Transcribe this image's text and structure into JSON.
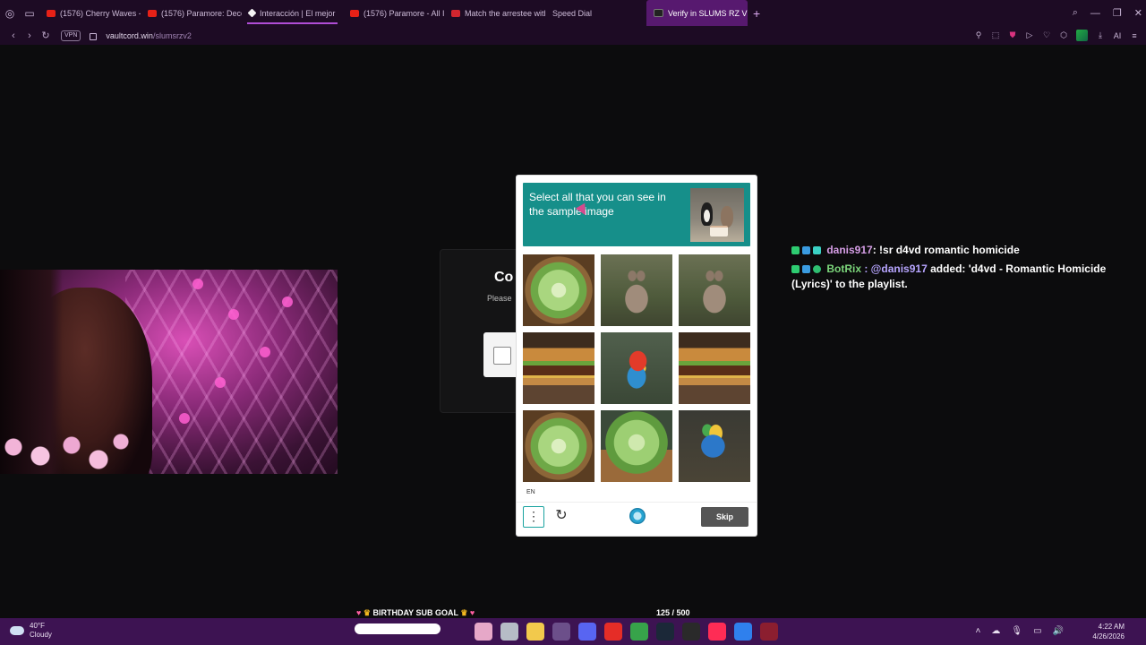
{
  "browser": {
    "tabs": [
      {
        "label": "(1576) Cherry Waves - Yo",
        "favicon": "youtube-icon",
        "active": false
      },
      {
        "label": "(1576) Paramore: Decode",
        "favicon": "youtube-icon",
        "active": false
      },
      {
        "label": "Interacción | El mejor",
        "favicon": "diamond-icon",
        "active": false
      },
      {
        "label": "(1576) Paramore - All I W",
        "favicon": "youtube-icon",
        "active": false
      },
      {
        "label": "Match the arrestee with t",
        "favicon": "news-icon",
        "active": false
      },
      {
        "label": "Speed Dial",
        "favicon": "grid-icon",
        "active": false
      },
      {
        "label": "Verify in SLUMS RZ V2 | N",
        "favicon": "site-icon",
        "active": true
      }
    ],
    "url_host": "vaultcord.win",
    "url_path": "/slumsrzv2",
    "vpn_label": "VPN",
    "ai_label": "AI"
  },
  "background_page": {
    "title_fragment": "Co",
    "subtitle_fragment": "Please"
  },
  "captcha": {
    "prompt": "Select all that you can see in the sample image",
    "tiles": [
      {
        "name": "cabbage-bowl",
        "kind": "cabbage"
      },
      {
        "name": "rabbit",
        "kind": "rabbit"
      },
      {
        "name": "rabbit",
        "kind": "rabbit"
      },
      {
        "name": "burger",
        "kind": "burger"
      },
      {
        "name": "parrot",
        "kind": "parrot"
      },
      {
        "name": "burger",
        "kind": "burger"
      },
      {
        "name": "cabbage-bowl",
        "kind": "cabbage"
      },
      {
        "name": "cabbage-pot",
        "kind": "cabbage-pot"
      },
      {
        "name": "parrot-blue",
        "kind": "parrot-blue"
      }
    ],
    "language": "EN",
    "skip_label": "Skip"
  },
  "chat": [
    {
      "user": "danis917",
      "text": ": !sr d4vd romantic homicide",
      "mention": ""
    },
    {
      "user": "BotRix",
      "text": " added: 'd4vd - Romantic Homicide (Lyrics)' to the playlist.",
      "mention": " : @danis917"
    }
  ],
  "stream_overlay": {
    "sub_goal": "BIRTHDAY SUB GOAL",
    "sub_count": "125 / 500"
  },
  "taskbar": {
    "temperature": "40°F",
    "condition": "Cloudy",
    "time": "4:22 AM",
    "date": "4/26/2026"
  },
  "colors": {
    "captcha_header": "#168f8a",
    "tab_active": "#57196f",
    "taskbar": "#3d1352"
  }
}
